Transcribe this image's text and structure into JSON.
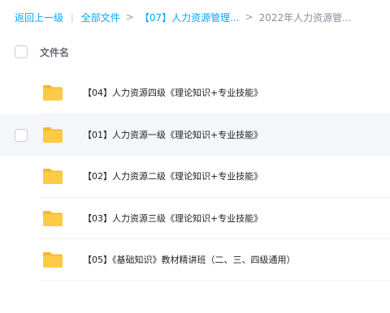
{
  "breadcrumb": {
    "back": "返回上一级",
    "all_files": "全部文件",
    "level1": "【07】人力资源管理...",
    "current": "2022年人力资源管..."
  },
  "header": {
    "column_name": "文件名"
  },
  "files": [
    {
      "name": "【04】人力资源四级《理论知识+专业技能》",
      "icon": "folder-icon"
    },
    {
      "name": "【01】人力资源一级《理论知识+专业技能》",
      "icon": "folder-icon"
    },
    {
      "name": "【02】人力资源二级《理论知识+专业技能》",
      "icon": "folder-icon"
    },
    {
      "name": "【03】人力资源三级《理论知识+专业技能》",
      "icon": "folder-icon"
    },
    {
      "name": "【05】《基础知识》教材精讲班（二、三、四级通用）",
      "icon": "folder-icon"
    }
  ],
  "colors": {
    "accent": "#06a7ff",
    "folder": "#ffc53d",
    "hover_row": "#f5f6fa"
  }
}
